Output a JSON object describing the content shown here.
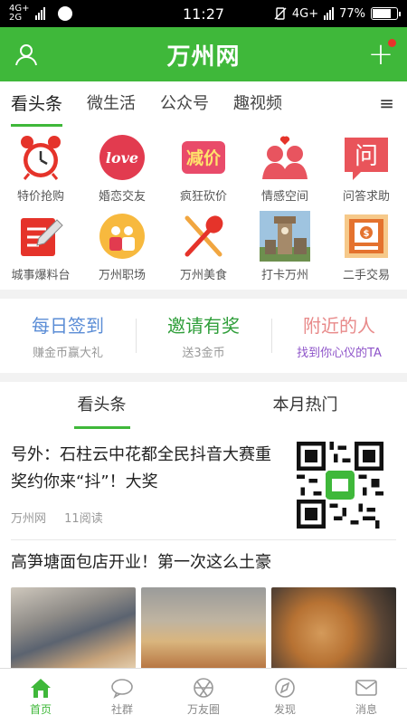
{
  "status_bar": {
    "network_top": "4G+",
    "network_bottom": "2G",
    "time": "11:27",
    "right_network": "4G+",
    "battery_text": "77%",
    "battery_level": 0.77
  },
  "header": {
    "title": "万州网",
    "brand_color": "#3fb83a",
    "user_icon": "user-icon",
    "add_icon": "plus-icon"
  },
  "channel_tabs": [
    {
      "label": "看头条",
      "active": true
    },
    {
      "label": "微生活",
      "active": false
    },
    {
      "label": "公众号",
      "active": false
    },
    {
      "label": "趣视频",
      "active": false
    }
  ],
  "channel_menu_icon": "≡",
  "grid": [
    {
      "label": "特价抢购",
      "icon": "alarm-clock-icon"
    },
    {
      "label": "婚恋交友",
      "icon": "love-icon"
    },
    {
      "label": "疯狂砍价",
      "icon": "price-cut-icon"
    },
    {
      "label": "情感空间",
      "icon": "couple-icon"
    },
    {
      "label": "问答求助",
      "icon": "question-icon"
    },
    {
      "label": "城事爆料台",
      "icon": "edit-board-icon"
    },
    {
      "label": "万州职场",
      "icon": "workers-icon"
    },
    {
      "label": "万州美食",
      "icon": "fork-spoon-icon"
    },
    {
      "label": "打卡万州",
      "icon": "tower-icon"
    },
    {
      "label": "二手交易",
      "icon": "money-box-icon"
    }
  ],
  "grid_icon_text": {
    "love": "love",
    "price_cut": "减价",
    "question": "问"
  },
  "quick_actions": [
    {
      "title": "每日签到",
      "subtitle": "赚金币赢大礼",
      "title_color": "#5b8dd6"
    },
    {
      "title": "邀请有奖",
      "subtitle": "送3金币",
      "title_color": "#2f9e3a"
    },
    {
      "title": "附近的人",
      "subtitle": "找到你心仪的TA",
      "title_color": "#e88a8a",
      "subtitle_color": "#8e54c9"
    }
  ],
  "feed_tabs": [
    {
      "label": "看头条",
      "active": true
    },
    {
      "label": "本月热门",
      "active": false
    }
  ],
  "articles": [
    {
      "title": "号外：石柱云中花都全民抖音大赛重奖约你来“抖”！大奖",
      "source": "万州网",
      "reads": "11阅读",
      "image": "qr-code-image"
    },
    {
      "title": "高笋塘面包店开业！第一次这么土豪",
      "images": [
        "bread-photo-1",
        "bread-photo-2",
        "bread-photo-3"
      ]
    }
  ],
  "bottom_nav": [
    {
      "label": "首页",
      "icon": "home-icon",
      "active": true
    },
    {
      "label": "社群",
      "icon": "chat-icon",
      "active": false
    },
    {
      "label": "万友圈",
      "icon": "aperture-icon",
      "active": false
    },
    {
      "label": "发现",
      "icon": "compass-icon",
      "active": false
    },
    {
      "label": "消息",
      "icon": "mail-icon",
      "active": false
    }
  ]
}
